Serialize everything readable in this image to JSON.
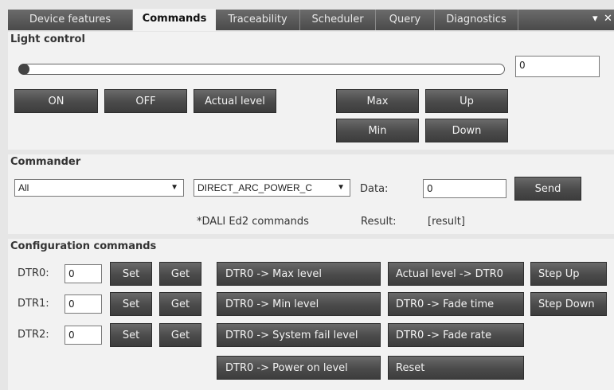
{
  "tabs": [
    "Device features",
    "Commands",
    "Traceability",
    "Scheduler",
    "Query",
    "Diagnostics"
  ],
  "tab_controls": {
    "pin": "▾",
    "close": "✕"
  },
  "light_control": {
    "title": "Light control",
    "slider_value": 0,
    "level_value": "0",
    "buttons": {
      "on": "ON",
      "off": "OFF",
      "actual_level": "Actual level",
      "max": "Max",
      "up": "Up",
      "min": "Min",
      "down": "Down"
    }
  },
  "commander": {
    "title": "Commander",
    "address_select": "All",
    "command_select": "DIRECT_ARC_POWER_C",
    "data_label": "Data:",
    "data_value": "0",
    "send": "Send",
    "note": "*DALI Ed2 commands",
    "result_label": "Result:",
    "result_value": "[result]"
  },
  "config": {
    "title": "Configuration commands",
    "dtr": [
      {
        "label": "DTR0:",
        "value": "0",
        "set": "Set",
        "get": "Get"
      },
      {
        "label": "DTR1:",
        "value": "0",
        "set": "Set",
        "get": "Get"
      },
      {
        "label": "DTR2:",
        "value": "0",
        "set": "Set",
        "get": "Get"
      }
    ],
    "col1": [
      "DTR0 -> Max level",
      "DTR0 -> Min level",
      "DTR0 -> System fail level",
      "DTR0 -> Power on level"
    ],
    "col2": [
      "Actual level -> DTR0",
      "DTR0 -> Fade time",
      "DTR0 -> Fade rate",
      "Reset"
    ],
    "col3": [
      "Step Up",
      "Step Down"
    ]
  }
}
